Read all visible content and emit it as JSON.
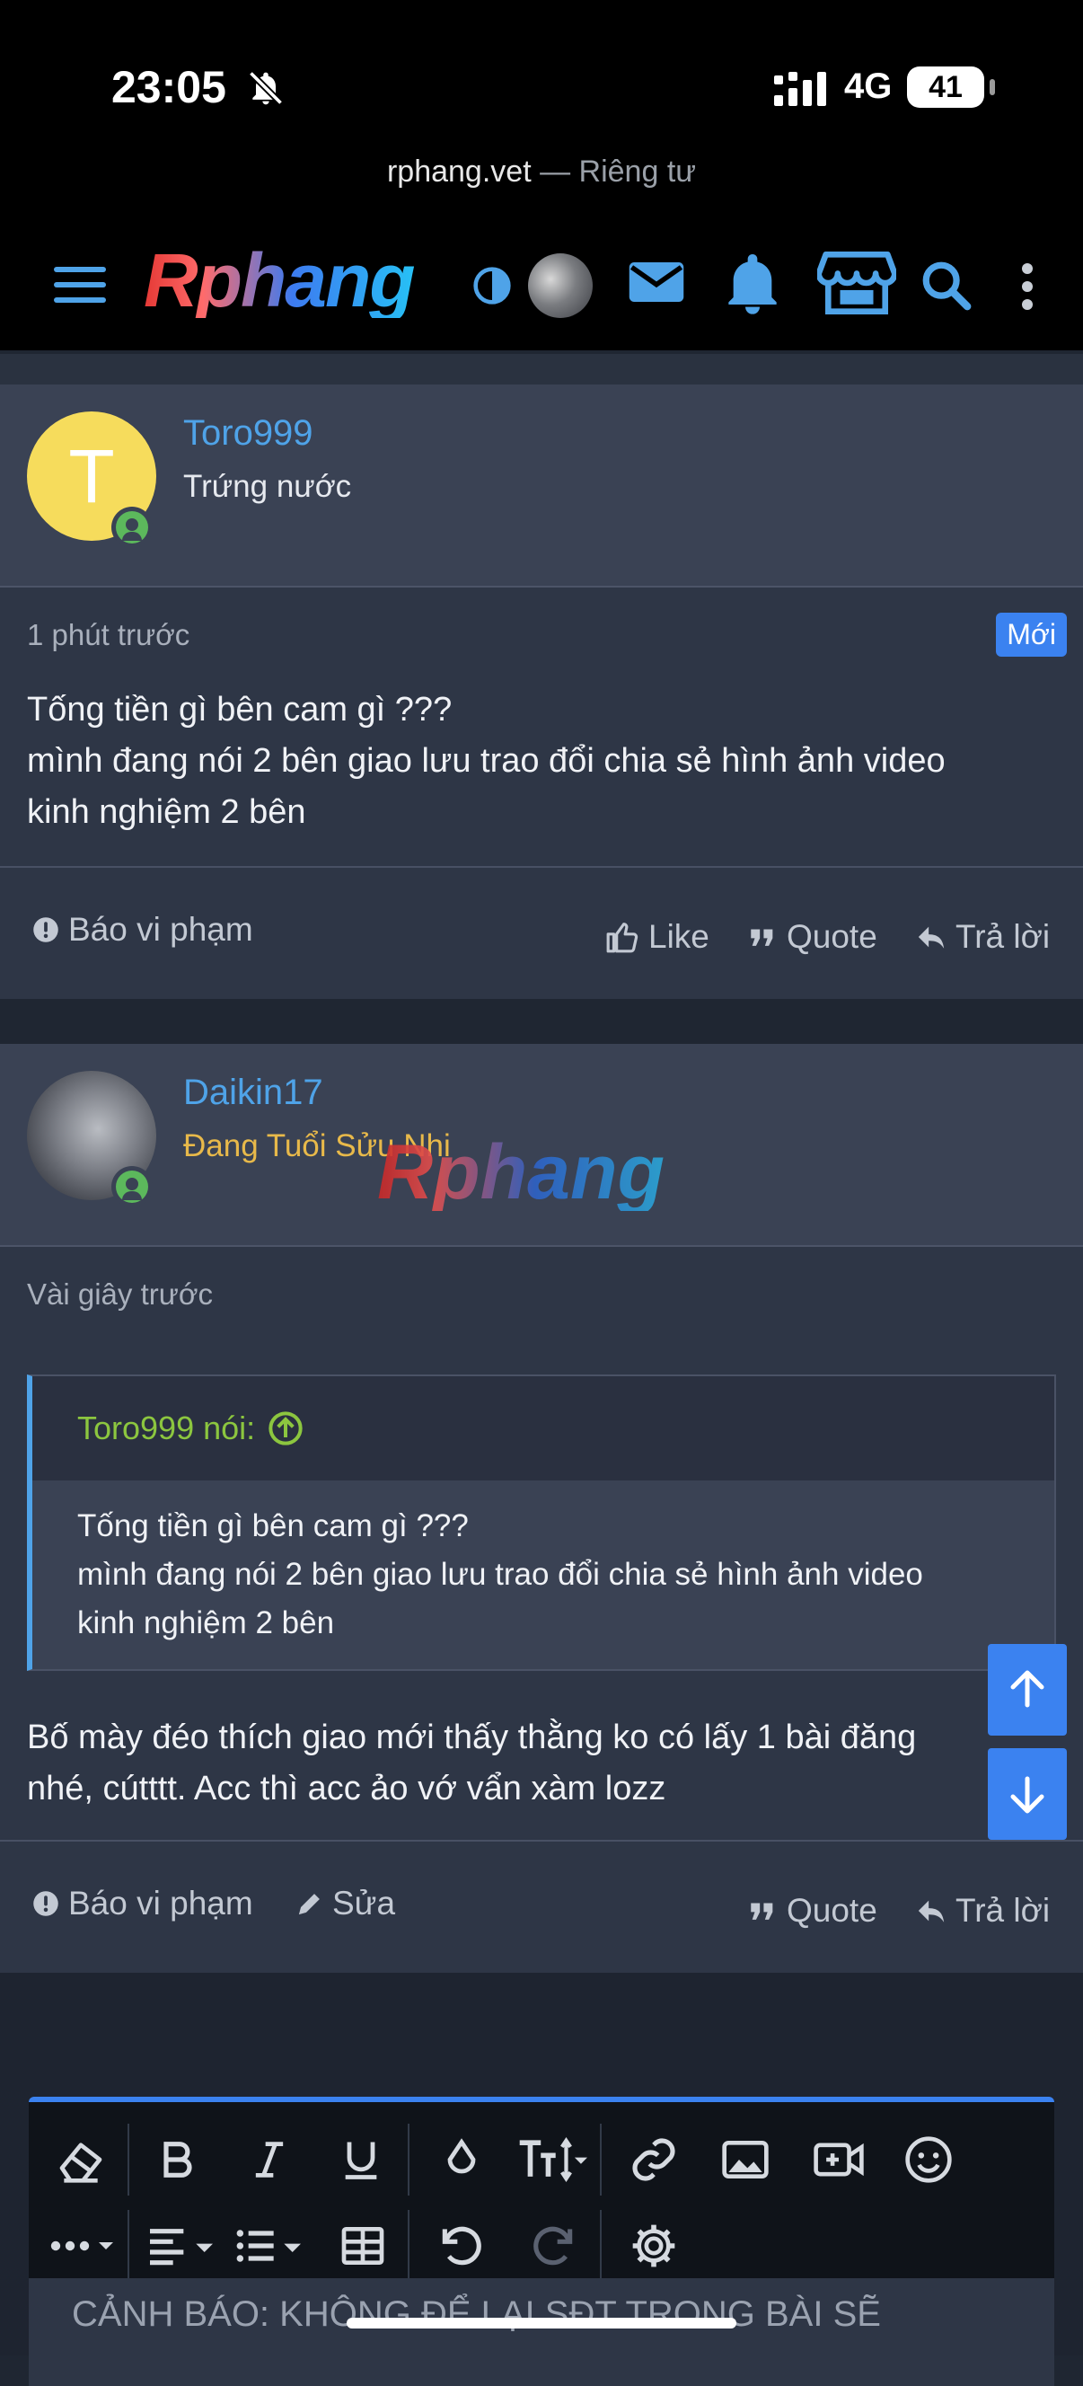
{
  "status_bar": {
    "time": "23:05",
    "network": "4G",
    "battery": "41"
  },
  "browser": {
    "domain": "rphang.vet",
    "privacy": "— Riêng tư"
  },
  "nav": {
    "logo": "Rphang"
  },
  "posts": [
    {
      "username": "Toro999",
      "avatar_letter": "T",
      "user_title": "Trứng nước",
      "time": "1 phút trước",
      "badge": "Mới",
      "lines": [
        "Tống tiền gì bên cam gì ???",
        "mình đang nói 2 bên giao lưu trao đổi chia sẻ hình ảnh video",
        "kinh nghiệm 2 bên"
      ],
      "actions": {
        "report": "Báo vi phạm",
        "like": "Like",
        "quote": "Quote",
        "reply": "Trả lời"
      }
    },
    {
      "username": "Daikin17",
      "user_title": "Đang Tuổi Sửu Nhi",
      "time": "Vài giây trước",
      "quote": {
        "author": "Toro999 nói:",
        "lines": [
          "Tống tiền gì bên cam gì ???",
          "mình đang nói 2 bên giao lưu trao đổi chia sẻ hình ảnh video",
          "kinh nghiệm 2 bên"
        ]
      },
      "lines": [
        "Bố mày đéo thích giao mới thấy thằng ko có lấy 1 bài đăng",
        "nhé, cútttt. Acc thì acc ảo vớ vẩn xàm lozz"
      ],
      "actions": {
        "report": "Báo vi phạm",
        "edit": "Sửa",
        "quote": "Quote",
        "reply": "Trả lời"
      }
    }
  ],
  "watermark": "Rphang",
  "editor": {
    "warning": "CẢNH BÁO: KHÔNG ĐỂ LẠI SĐT TRONG BÀI SẼ"
  }
}
